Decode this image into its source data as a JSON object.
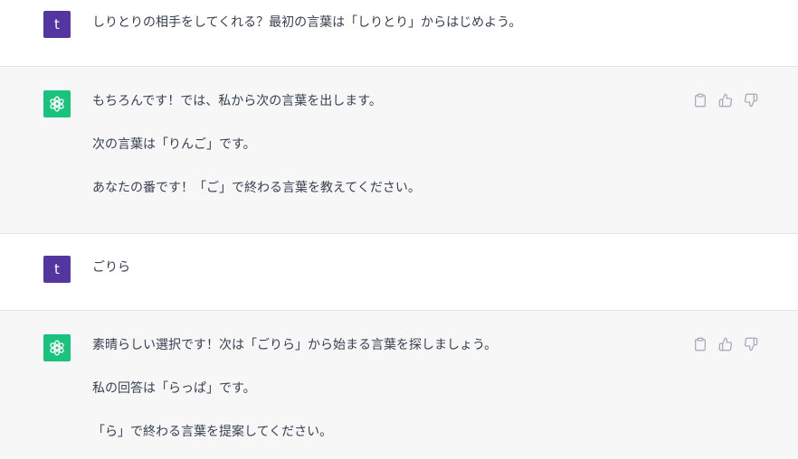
{
  "conversation": [
    {
      "role": "user",
      "avatar_letter": "t",
      "paragraphs": [
        "しりとりの相手をしてくれる？最初の言葉は「しりとり」からはじめよう。"
      ]
    },
    {
      "role": "assistant",
      "paragraphs": [
        "もちろんです！では、私から次の言葉を出します。",
        "次の言葉は「りんご」です。",
        "あなたの番です！「ご」で終わる言葉を教えてください。"
      ]
    },
    {
      "role": "user",
      "avatar_letter": "t",
      "paragraphs": [
        "ごりら"
      ]
    },
    {
      "role": "assistant",
      "paragraphs": [
        "素晴らしい選択です！次は「ごりら」から始まる言葉を探しましょう。",
        "私の回答は「らっぱ」です。",
        "「ら」で終わる言葉を提案してください。"
      ]
    }
  ],
  "actions": {
    "copy_icon": "clipboard-icon",
    "like_icon": "thumbs-up-icon",
    "dislike_icon": "thumbs-down-icon"
  },
  "colors": {
    "user_avatar": "#5436a0",
    "assistant_avatar": "#19c37d",
    "assistant_bg": "#f7f7f8",
    "text": "#374151",
    "icon": "#acacbe"
  }
}
